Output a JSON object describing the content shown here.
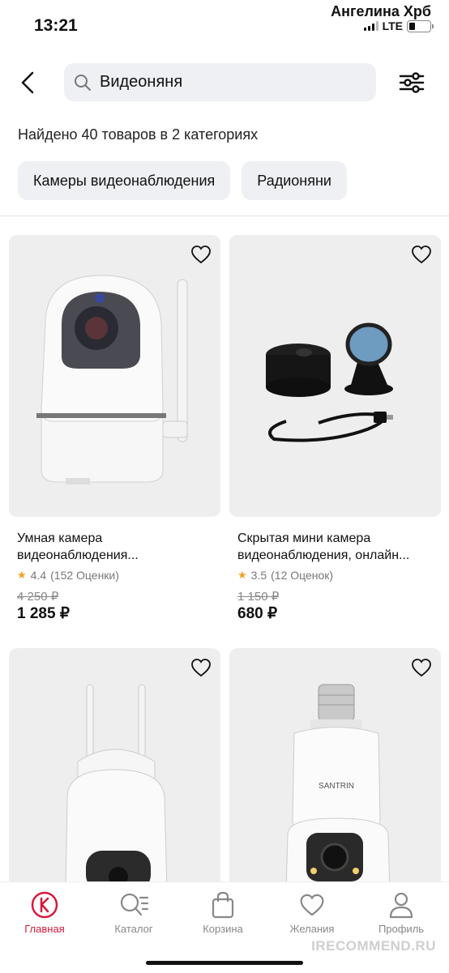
{
  "status": {
    "time": "13:21",
    "carrier": "Ангелина Хрб",
    "network": "LTE"
  },
  "header": {
    "search_value": "Видеоняня",
    "search_placeholder": ""
  },
  "results": {
    "found_text": "Найдено 40 товаров в 2 категориях",
    "chips": [
      "Камеры видеонаблюдения",
      "Радионяни"
    ]
  },
  "products": [
    {
      "title": "Умная камера видеонаблюдения...",
      "rating": "4.4",
      "reviews": "(152 Оценки)",
      "old_price": "4 250 ₽",
      "price": "1 285 ₽"
    },
    {
      "title": "Скрытая мини камера видеонаблюдения, онлайн...",
      "rating": "3.5",
      "reviews": "(12 Оценок)",
      "old_price": "1 150 ₽",
      "price": "680 ₽"
    },
    {
      "title": "",
      "brand_on_image": "SANTRIN"
    }
  ],
  "tabbar": {
    "items": [
      "Главная",
      "Каталог",
      "Корзина",
      "Желания",
      "Профиль"
    ],
    "active": "Главная"
  },
  "watermark": "IRECOMMEND.RU",
  "colors": {
    "accent": "#d7193b",
    "chip_bg": "#eef0f3",
    "card_bg": "#eeeeee",
    "star": "#f0a020"
  }
}
